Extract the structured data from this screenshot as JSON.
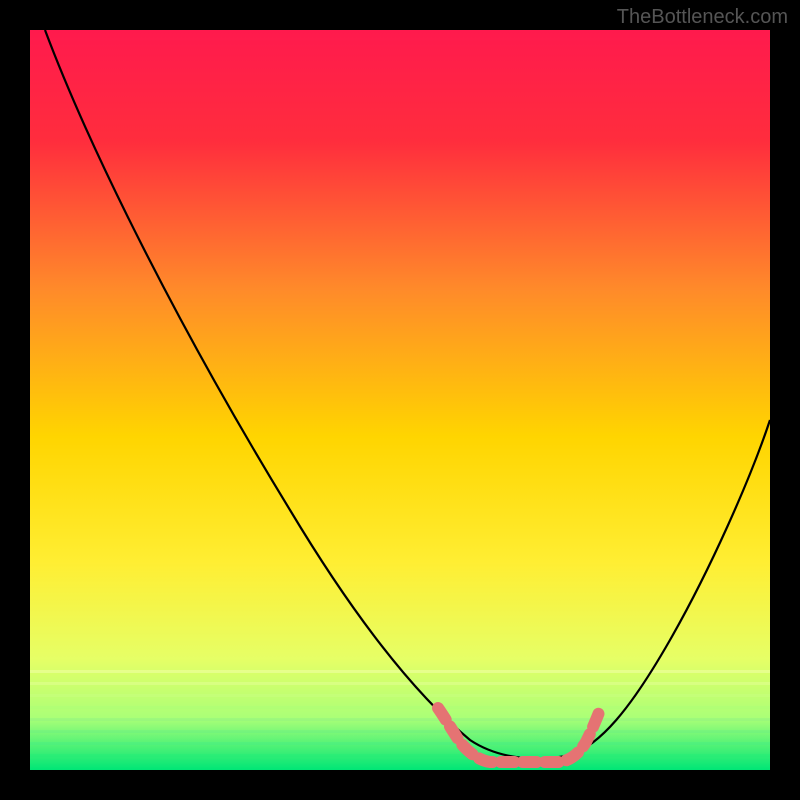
{
  "watermark": "TheBottleneck.com",
  "chart_data": {
    "type": "line",
    "title": "",
    "xlabel": "",
    "ylabel": "",
    "xlim": [
      0,
      100
    ],
    "ylim": [
      0,
      100
    ],
    "series": [
      {
        "name": "curve",
        "x": [
          2,
          10,
          20,
          30,
          40,
          50,
          55,
          60,
          65,
          70,
          75,
          80,
          85,
          90,
          95,
          100
        ],
        "y": [
          100,
          87,
          70,
          54,
          38,
          22,
          14,
          7,
          3,
          1,
          1,
          4,
          12,
          24,
          36,
          48
        ]
      }
    ],
    "highlight": {
      "name": "bottom-segment",
      "x_range": [
        55,
        78
      ],
      "color": "#e57373"
    },
    "background_gradient": {
      "top": "#ff0044",
      "upper_mid": "#ff7733",
      "mid": "#ffee00",
      "lower_mid": "#eeff66",
      "bottom": "#00e676"
    }
  }
}
